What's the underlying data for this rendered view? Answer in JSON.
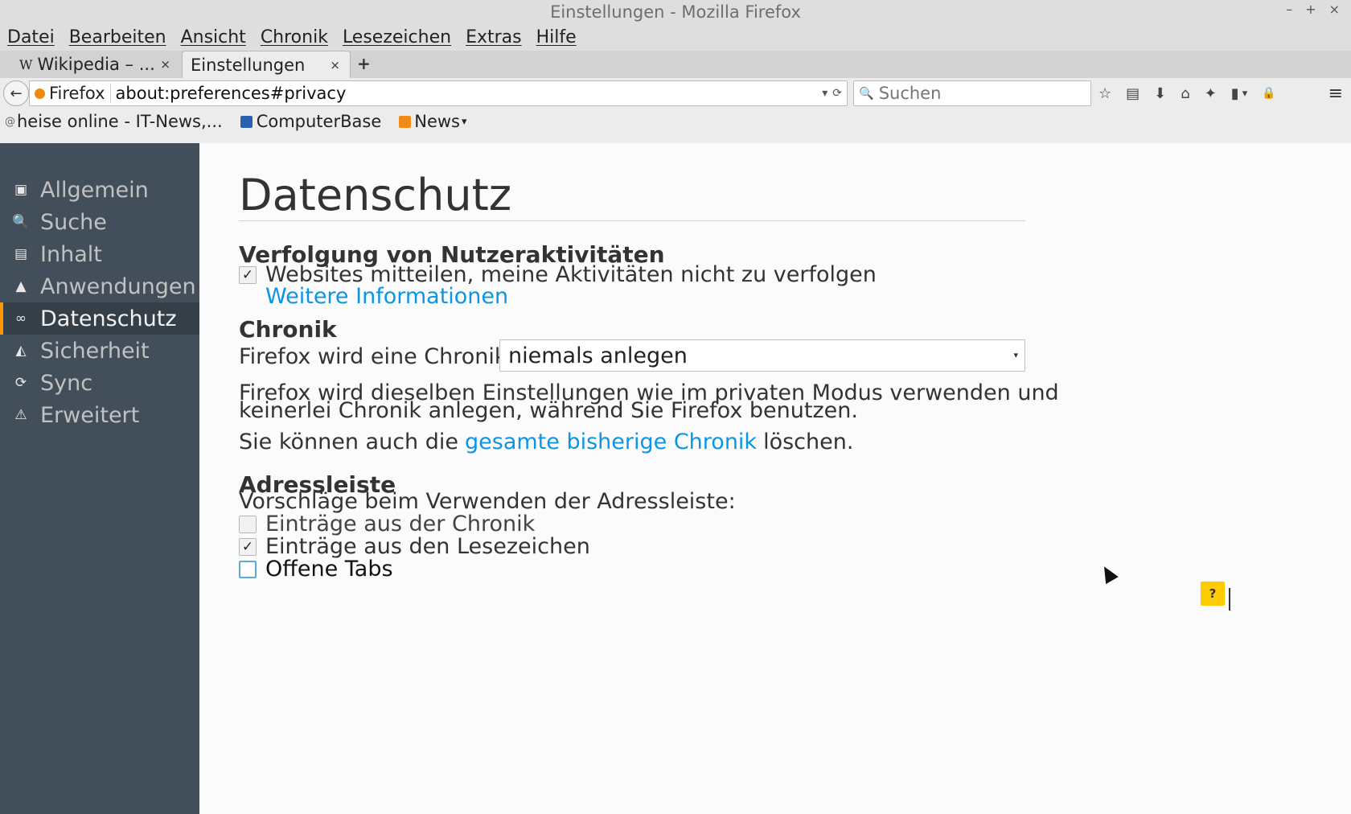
{
  "window": {
    "title": "Einstellungen - Mozilla Firefox",
    "controls": [
      "–",
      "+",
      "×"
    ]
  },
  "menu": [
    "Datei",
    "Bearbeiten",
    "Ansicht",
    "Chronik",
    "Lesezeichen",
    "Extras",
    "Hilfe"
  ],
  "tabs": [
    {
      "label": "Wikipedia – ...",
      "icon": "wikipedia-icon"
    },
    {
      "label": "Einstellungen",
      "icon": "preferences-icon",
      "active": true
    }
  ],
  "tab_close_glyph": "×",
  "new_tab_glyph": "+",
  "navbar": {
    "back_glyph": "←",
    "identity_label": "Firefox",
    "url": "about:preferences#privacy",
    "url_dropdown_glyph": "▾",
    "url_reload_glyph": "⟳",
    "search_glyph": "🔍",
    "search_placeholder": "Suchen",
    "toolbar_glyphs": {
      "bookmark": "☆",
      "library": "▤",
      "downloads": "⬇",
      "home": "⌂",
      "sync": "✦",
      "clipboard": "▮",
      "dropdown": "▾",
      "lock": "🔒"
    },
    "menu_glyph": "≡"
  },
  "bookmarks": [
    {
      "label": "heise online - IT-News,...",
      "icon": "heise-icon"
    },
    {
      "label": "ComputerBase",
      "icon": "computerbase-icon"
    },
    {
      "label": "News",
      "icon": "rss-icon",
      "dropdown": true
    }
  ],
  "bookmark_icon_glyph": "@",
  "sidebar": {
    "items": [
      {
        "label": "Allgemein",
        "icon": "general-icon",
        "glyph": "▣"
      },
      {
        "label": "Suche",
        "icon": "search-icon",
        "glyph": "🔍"
      },
      {
        "label": "Inhalt",
        "icon": "content-icon",
        "glyph": "▤"
      },
      {
        "label": "Anwendungen",
        "icon": "applications-icon",
        "glyph": "▲"
      },
      {
        "label": "Datenschutz",
        "icon": "privacy-mask-icon",
        "glyph": "∞",
        "selected": true
      },
      {
        "label": "Sicherheit",
        "icon": "security-icon",
        "glyph": "◭"
      },
      {
        "label": "Sync",
        "icon": "sync-icon",
        "glyph": "⟳"
      },
      {
        "label": "Erweitert",
        "icon": "advanced-icon",
        "glyph": "⚠"
      }
    ]
  },
  "main": {
    "title": "Datenschutz",
    "tracking": {
      "heading": "Verfolgung von Nutzeraktivitäten",
      "dnt_label": "Websites mitteilen, meine Aktivitäten nicht zu verfolgen",
      "dnt_checked": true,
      "learn_more": "Weitere Informationen"
    },
    "history": {
      "heading": "Chronik",
      "mode_label": "Firefox wird eine Chronik:",
      "mode_value": "niemals anlegen",
      "description_line1": "Firefox wird dieselben Einstellungen wie im privaten Modus verwenden und",
      "description_line2": "keinerlei Chronik anlegen, während Sie Firefox benutzen.",
      "clear_prefix": "Sie können auch die",
      "clear_link": "gesamte bisherige Chronik",
      "clear_suffix": "löschen."
    },
    "location_bar": {
      "heading": "Adressleiste",
      "suggest_label": "Vorschläge beim Verwenden der Adressleiste:",
      "options": [
        {
          "label": "Einträge aus der Chronik",
          "checked": false,
          "disabled": true
        },
        {
          "label": "Einträge aus den Lesezeichen",
          "checked": true
        },
        {
          "label": "Offene Tabs",
          "checked": false,
          "focused": true
        }
      ]
    },
    "help_label": "?",
    "check_glyph": "✓",
    "select_arrow_glyph": "▾"
  },
  "colors": {
    "sidebar_bg": "#424f5a",
    "sidebar_selected_bg": "#343f48",
    "selection_accent": "#ff9500",
    "link": "#0b96e5",
    "help_button": "#ffcb00"
  }
}
